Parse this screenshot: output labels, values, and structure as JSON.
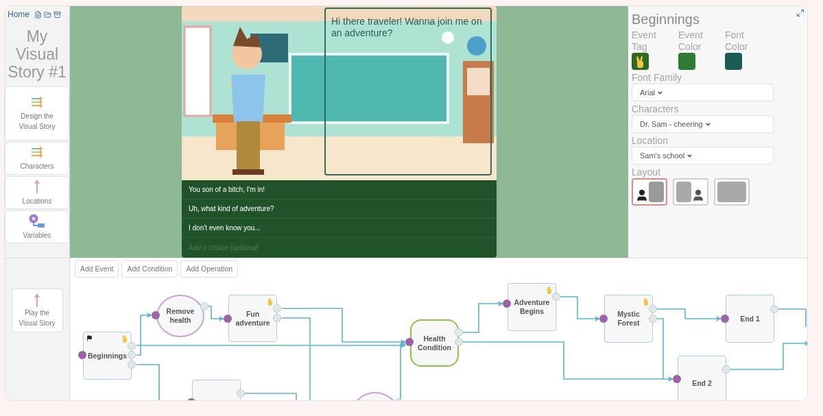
{
  "header": {
    "home": "Home"
  },
  "story_title": "My Visual Story #1",
  "nav": [
    {
      "label": "Design the Visual Story",
      "kind": "sliders"
    },
    {
      "label": "Characters",
      "kind": "sliders"
    },
    {
      "label": "Locations",
      "kind": "pin"
    },
    {
      "label": "Variables",
      "kind": "key"
    }
  ],
  "play": {
    "label": "Play the Visual Story",
    "kind": "pin"
  },
  "scene": {
    "dialogue": "Hi there traveler! Wanna join me on an adventure?",
    "choices": [
      "You son of a bitch, I'm in!",
      "Uh, what kind of adventure?",
      "I don't even know you..."
    ],
    "choice_placeholder": "Add a choice (optional)"
  },
  "inspector": {
    "title": "Beginnings",
    "swatches": [
      {
        "label": "Event Tag",
        "kind": "tag",
        "color": "#2e6b1f"
      },
      {
        "label": "Event Color",
        "kind": "color",
        "color": "#2f7a34"
      },
      {
        "label": "Font Color",
        "kind": "color",
        "color": "#1b5c56"
      }
    ],
    "fields": [
      {
        "label": "Font Family",
        "value": "Arial"
      },
      {
        "label": "Characters",
        "value": "Dr. Sam - cheering"
      },
      {
        "label": "Location",
        "value": "Sam's school"
      }
    ],
    "layout": {
      "label": "Layout",
      "options": [
        {
          "kind": "left",
          "selected": true
        },
        {
          "kind": "right",
          "selected": false
        },
        {
          "kind": "full",
          "selected": false
        }
      ]
    }
  },
  "toolbar": [
    "Add Event",
    "Add Condition",
    "Add Operation"
  ],
  "graph": {
    "nodes": [
      {
        "kind": "event",
        "label": "Beginnings",
        "start": true,
        "tagged": true
      },
      {
        "kind": "operation",
        "label": "Remove health",
        "start": false,
        "tagged": false
      },
      {
        "kind": "event",
        "label": "Fun adventure",
        "start": false,
        "tagged": true
      },
      {
        "kind": "condition",
        "label": "Health Condition",
        "start": false,
        "tagged": false
      },
      {
        "kind": "event",
        "label": "Adventure Begins",
        "start": false,
        "tagged": true
      },
      {
        "kind": "event",
        "label": "Mystic Forest",
        "start": false,
        "tagged": true
      },
      {
        "kind": "event",
        "label": "End 1",
        "start": false,
        "tagged": false
      },
      {
        "kind": "event",
        "label": "End 2",
        "start": false,
        "tagged": false
      },
      {
        "kind": "event",
        "start": false,
        "tagged": false
      },
      {
        "kind": "operation",
        "start": false,
        "tagged": false
      }
    ]
  }
}
